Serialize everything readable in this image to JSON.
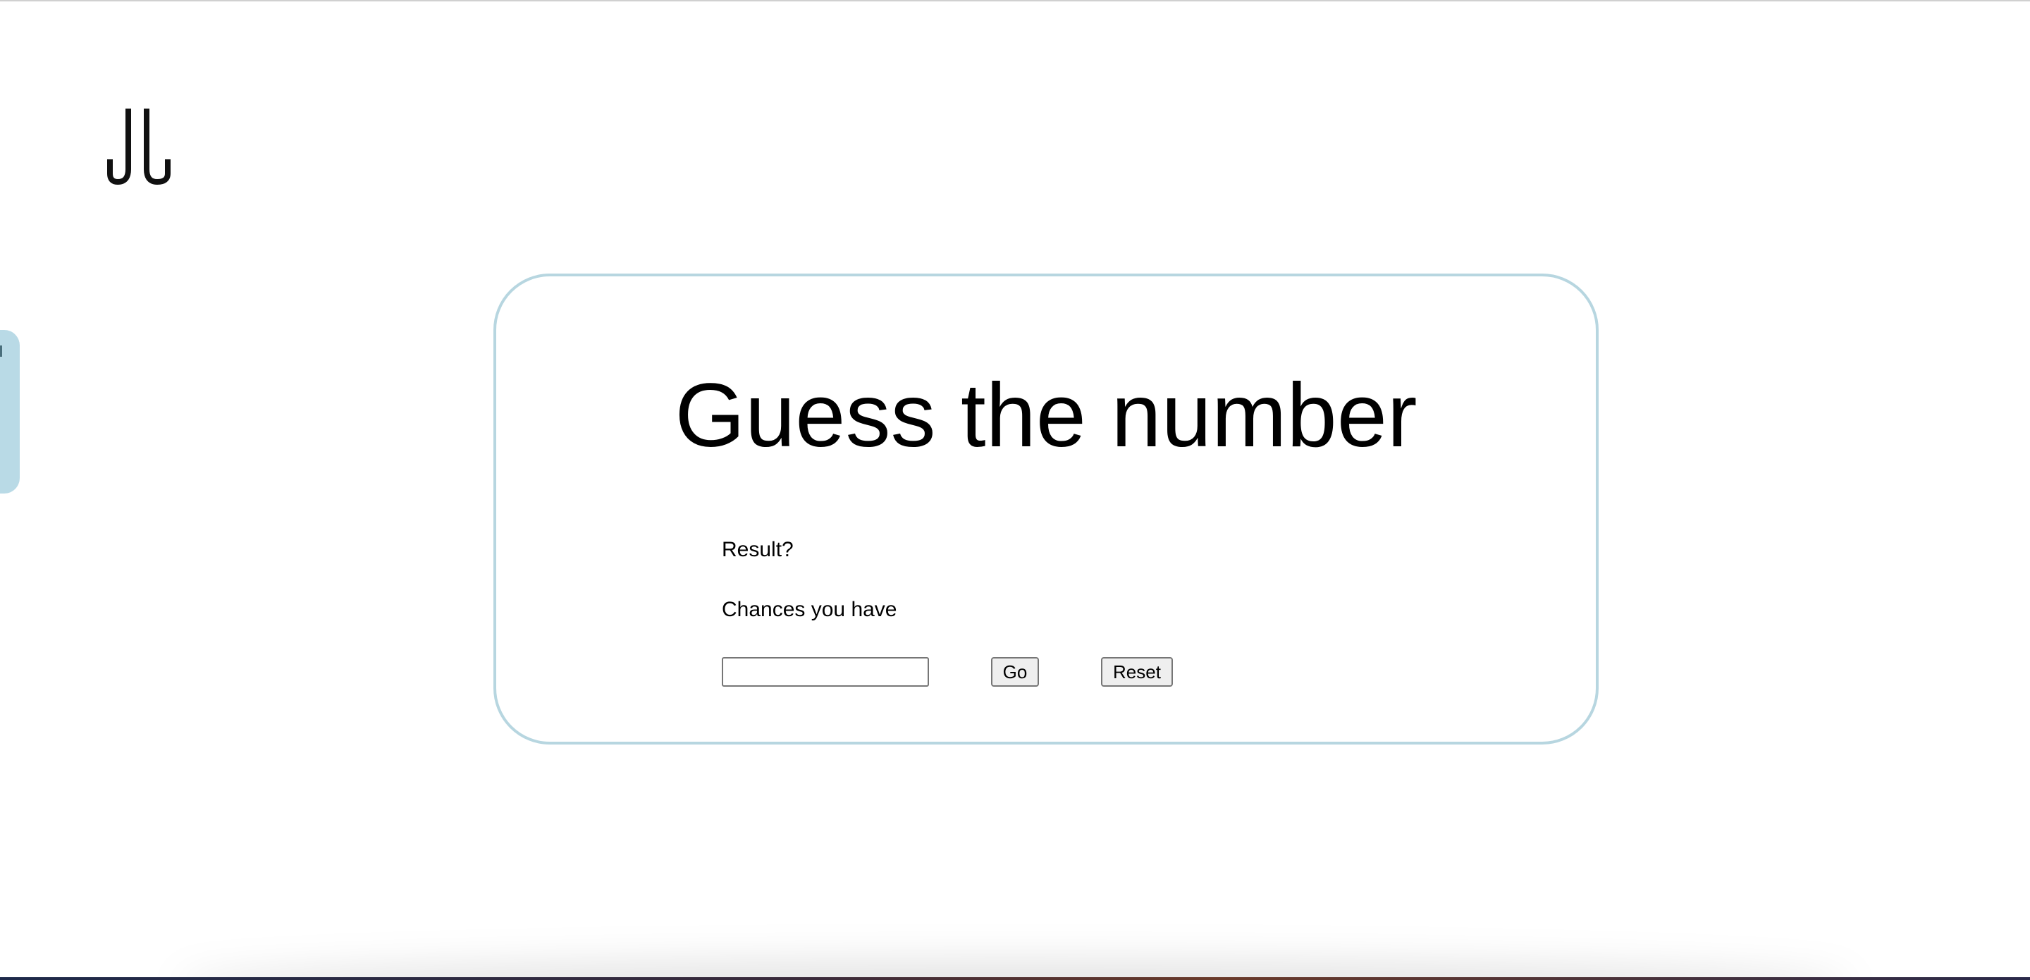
{
  "logo": {
    "icon": "jl-monogram-logo"
  },
  "side_tab": {
    "icon": "side-panel-tab",
    "color": "#b9dae6"
  },
  "card": {
    "border_color": "#b7d6e0",
    "title": "Guess the number",
    "result_label": "Result?",
    "chances_label": "Chances you have",
    "guess_input": {
      "value": "",
      "placeholder": ""
    },
    "go_label": "Go",
    "reset_label": "Reset"
  }
}
